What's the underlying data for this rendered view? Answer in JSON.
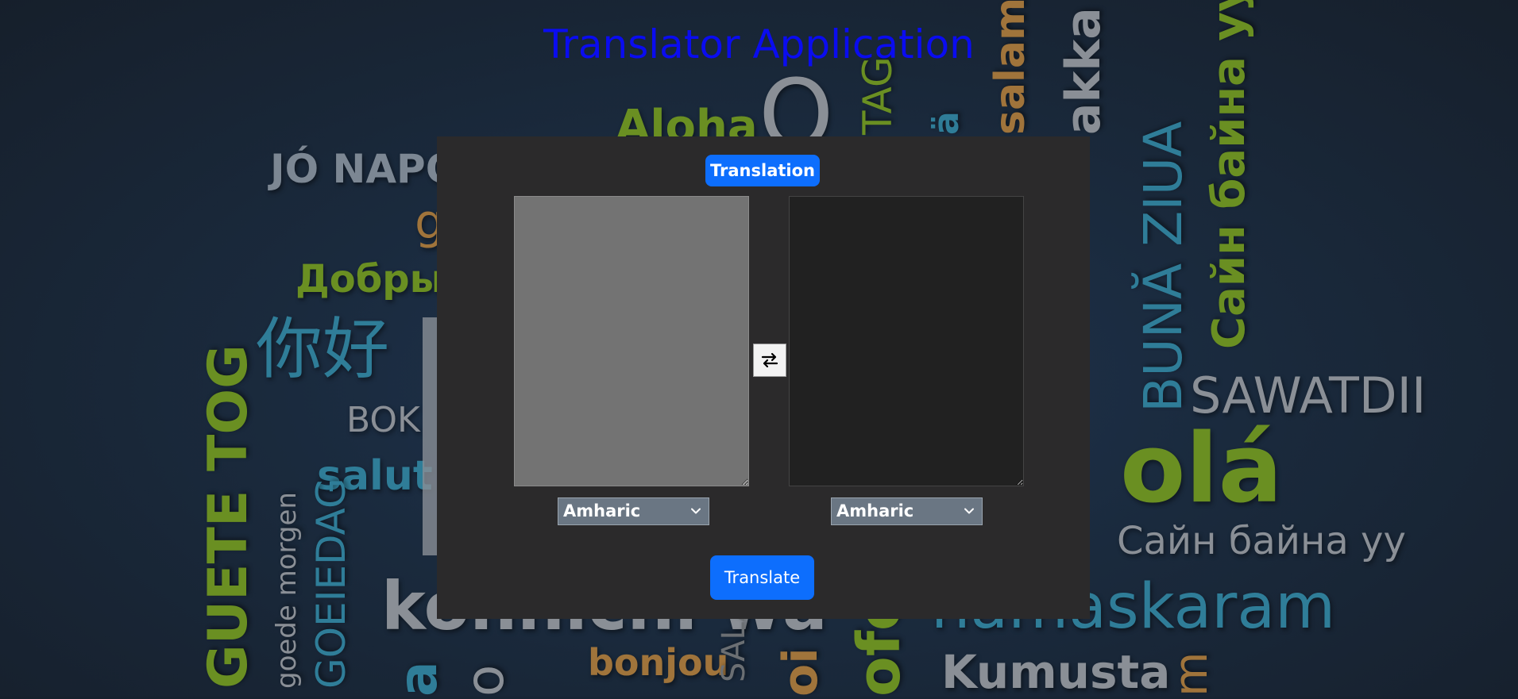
{
  "app": {
    "title": "Translator Application"
  },
  "background_words": [
    "JÓ NAPOT",
    "Aloha",
    "Добры",
    "你好",
    "BOK",
    "salut",
    "GUETE TOG",
    "goede morgen",
    "GOEIEDAG",
    "konnichi wa",
    "bonjou",
    "SALÂ",
    "Kumusta",
    "namaskaram",
    "Сайн байна уу",
    "olá",
    "SAWATDII",
    "BUNĂ ZIUA",
    "Сайн байна уу",
    "TAG",
    "ä",
    "salam",
    "akka",
    "a",
    "o",
    "g",
    "O",
    "oi",
    "ofo",
    "m"
  ],
  "panel": {
    "tab_label": "Translation",
    "source": {
      "text": "",
      "language": "Amharic"
    },
    "target": {
      "text": "",
      "language": "Amharic"
    },
    "swap_icon": "swap-arrows-icon",
    "translate_label": "Translate"
  },
  "colors": {
    "title": "#0a0cf0",
    "primary_button": "#0d6efd",
    "panel_bg": "#2b2a2b",
    "source_textarea_bg": "#737373",
    "target_textarea_bg": "#212121",
    "select_bg": "#6a7683"
  }
}
